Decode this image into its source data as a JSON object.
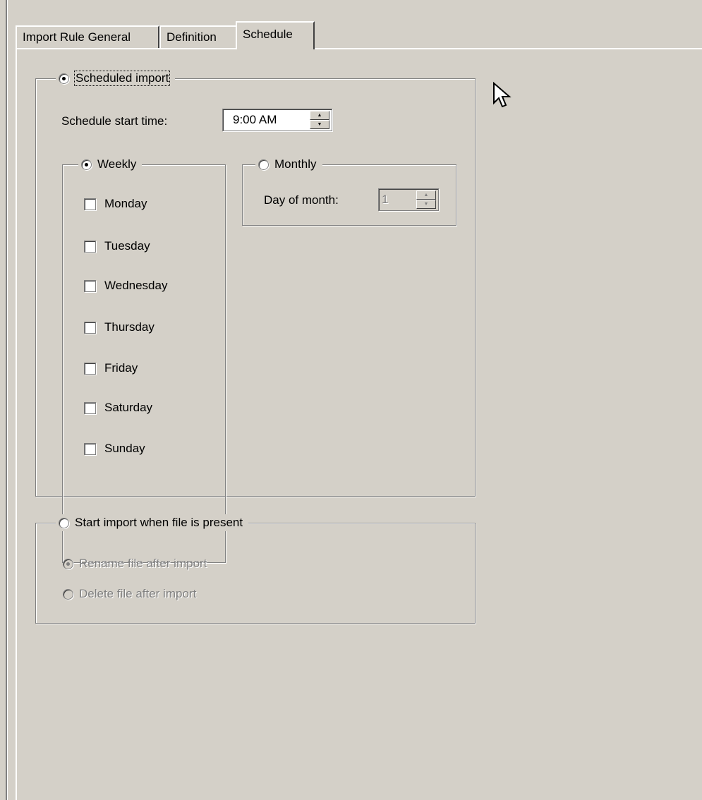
{
  "tabs": [
    {
      "label": "Import Rule General"
    },
    {
      "label": "Definition"
    },
    {
      "label": "Schedule",
      "active": true
    }
  ],
  "scheduled_import": {
    "label": "Scheduled import",
    "selected": true,
    "start_time_label": "Schedule start time:",
    "start_time_value": "9:00 AM",
    "weekly": {
      "label": "Weekly",
      "selected": true,
      "days": [
        {
          "label": "Monday",
          "checked": false
        },
        {
          "label": "Tuesday",
          "checked": false
        },
        {
          "label": "Wednesday",
          "checked": false
        },
        {
          "label": "Thursday",
          "checked": false
        },
        {
          "label": "Friday",
          "checked": false
        },
        {
          "label": "Saturday",
          "checked": false
        },
        {
          "label": "Sunday",
          "checked": false
        }
      ]
    },
    "monthly": {
      "label": "Monthly",
      "selected": false,
      "day_label": "Day of month:",
      "day_value": "1"
    }
  },
  "file_present": {
    "label": "Start import when file is present",
    "selected": false,
    "rename_label": "Rename file after import",
    "rename_selected": true,
    "delete_label": "Delete file after import",
    "delete_selected": false
  },
  "icons": {
    "cursor": "arrow-cursor-icon"
  },
  "colors": {
    "dialog_background": "#d4d0c8",
    "disabled_text": "#808080"
  }
}
